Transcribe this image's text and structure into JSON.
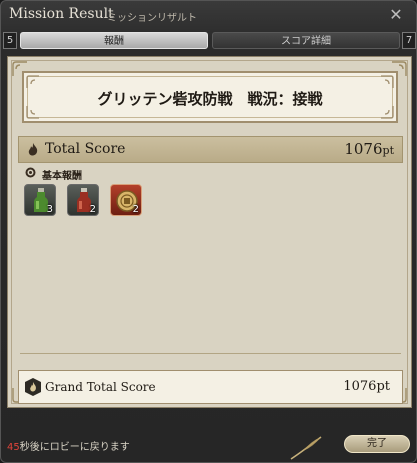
{
  "window": {
    "title": "Mission Result",
    "subtitle": "ミッションリザルト"
  },
  "tabs": [
    {
      "label": "報酬",
      "active": true
    },
    {
      "label": "スコア詳細",
      "active": false
    }
  ],
  "tab_numbers": {
    "left": "5",
    "right": "7"
  },
  "banner": {
    "text": "グリッテン砦攻防戦　戦況：接戦"
  },
  "total_score": {
    "label": "Total Score",
    "value": "1076",
    "unit": "pt"
  },
  "rewards": {
    "header": "基本報酬",
    "items": [
      {
        "icon": "green-potion-icon",
        "count": "3"
      },
      {
        "icon": "red-potion-icon",
        "count": "2"
      },
      {
        "icon": "gold-coin-icon",
        "count": "2"
      }
    ]
  },
  "grand_total": {
    "label": "Grand Total Score",
    "value": "1076pt"
  },
  "footer": {
    "countdown": "45",
    "message": "秒後にロビーに戻ります",
    "done_label": "完了"
  },
  "colors": {
    "accent_red": "#e0443a",
    "panel_bg": "#d9d3c2",
    "score_bar": "#c4b794"
  }
}
